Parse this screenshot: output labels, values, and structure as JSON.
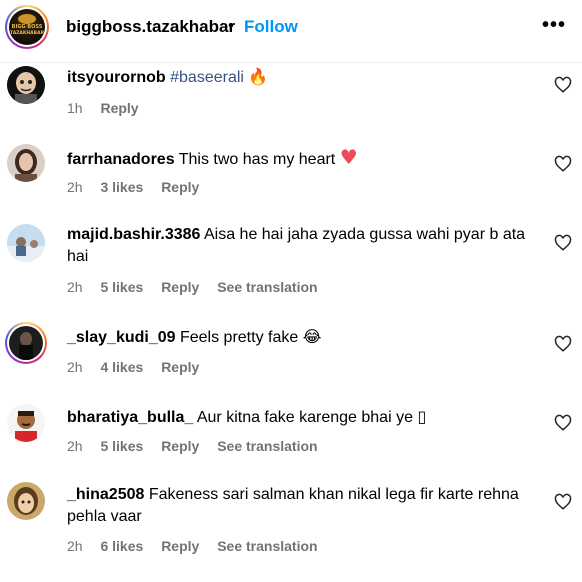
{
  "header": {
    "username": "biggboss.tazakhabar",
    "separator": "•",
    "follow_label": "Follow",
    "more_label": "•••",
    "logo_line1": "BIGG BOSS",
    "logo_line2": "TAZAKHABAR"
  },
  "comments": [
    {
      "username": "itsyourornob",
      "text": "",
      "tag": "#baseerali",
      "emoji": "🔥",
      "time": "1h",
      "likes": "",
      "reply_label": "Reply",
      "translation_label": ""
    },
    {
      "username": "farrhanadores",
      "text": "This two has my heart",
      "tag": "",
      "emoji": "♥",
      "time": "2h",
      "likes": "3 likes",
      "reply_label": "Reply",
      "translation_label": ""
    },
    {
      "username": "majid.bashir.3386",
      "text": "Aisa he hai jaha zyada gussa wahi pyar b ata hai",
      "tag": "",
      "emoji": "",
      "time": "2h",
      "likes": "5 likes",
      "reply_label": "Reply",
      "translation_label": "See translation"
    },
    {
      "username": "_slay_kudi_09",
      "text": "Feels pretty fake",
      "tag": "",
      "emoji": "😂",
      "time": "2h",
      "likes": "4 likes",
      "reply_label": "Reply",
      "translation_label": ""
    },
    {
      "username": "bharatiya_bulla_",
      "text": "Aur kitna fake karenge bhai ye",
      "tag": "",
      "emoji": "▯",
      "time": "2h",
      "likes": "5 likes",
      "reply_label": "Reply",
      "translation_label": "See translation"
    },
    {
      "username": "_hina2508",
      "text": "Fakeness sari salman khan nikal lega fir karte rehna pehla vaar",
      "tag": "",
      "emoji": "",
      "time": "2h",
      "likes": "6 likes",
      "reply_label": "Reply",
      "translation_label": "See translation"
    }
  ],
  "icons": {
    "like": "heart-outline-icon",
    "more": "more-horizontal-icon"
  },
  "colors": {
    "link": "#0095f6",
    "hashtag": "#385185",
    "meta": "#737373",
    "heart_emoji": "#ed4956"
  }
}
